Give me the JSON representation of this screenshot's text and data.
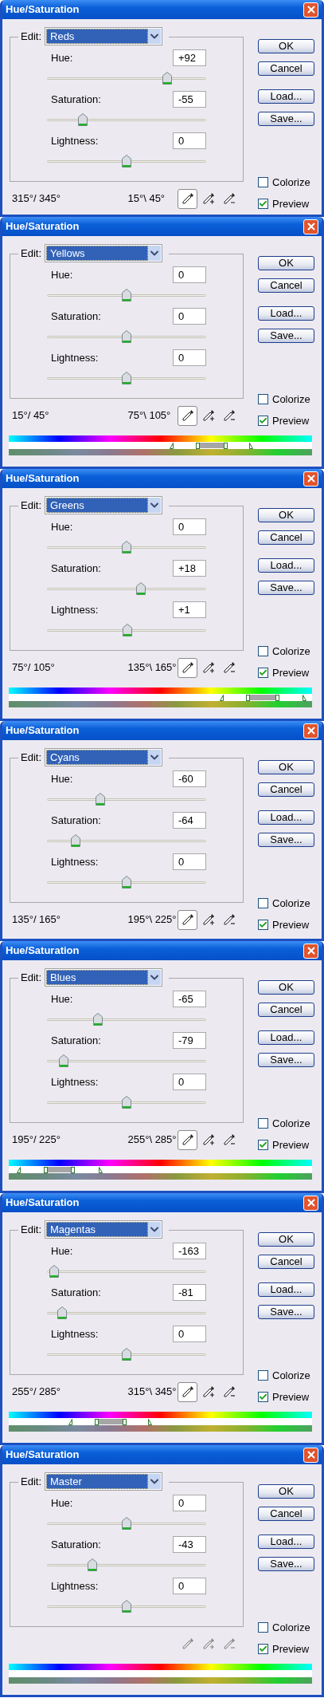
{
  "dialogs": [
    {
      "title": "Hue/Saturation",
      "edit_label": "Edit:",
      "edit_value": "Reds",
      "sliders": [
        {
          "label": "Hue:",
          "value": "+92",
          "level": 0.756
        },
        {
          "label": "Saturation:",
          "value": "-55",
          "level": 0.225
        },
        {
          "label": "Lightness:",
          "value": "0",
          "level": 0.5
        }
      ],
      "buttons": [
        "OK",
        "Cancel",
        "Load...",
        "Save..."
      ],
      "range_left": "315°/ 345°",
      "range_right": "15°\\ 45°",
      "eyedroppers": [
        {
          "kind": "plain",
          "selected": true,
          "disabled": false
        },
        {
          "kind": "add",
          "selected": false,
          "disabled": false
        },
        {
          "kind": "subtract",
          "selected": false,
          "disabled": false
        }
      ],
      "checkboxes": [
        {
          "label": "Colorize",
          "checked": false
        },
        {
          "label": "Preview",
          "checked": true
        }
      ],
      "color_bars": false
    },
    {
      "title": "Hue/Saturation",
      "edit_label": "Edit:",
      "edit_value": "Yellows",
      "sliders": [
        {
          "label": "Hue:",
          "value": "0",
          "level": 0.5
        },
        {
          "label": "Saturation:",
          "value": "0",
          "level": 0.5
        },
        {
          "label": "Lightness:",
          "value": "0",
          "level": 0.5
        }
      ],
      "buttons": [
        "OK",
        "Cancel",
        "Load...",
        "Save..."
      ],
      "range_left": "15°/ 45°",
      "range_right": "75°\\ 105°",
      "eyedroppers": [
        {
          "kind": "plain",
          "selected": true,
          "disabled": false
        },
        {
          "kind": "add",
          "selected": false,
          "disabled": false
        },
        {
          "kind": "subtract",
          "selected": false,
          "disabled": false
        }
      ],
      "checkboxes": [
        {
          "label": "Colorize",
          "checked": false
        },
        {
          "label": "Preview",
          "checked": true
        }
      ],
      "color_bars": true,
      "range_sliders": [
        {
          "level": 0.535
        },
        {
          "level": 0.622
        },
        {
          "level": 0.714
        },
        {
          "level": 0.798
        }
      ]
    },
    {
      "title": "Hue/Saturation",
      "edit_label": "Edit:",
      "edit_value": "Greens",
      "sliders": [
        {
          "label": "Hue:",
          "value": "0",
          "level": 0.5
        },
        {
          "label": "Saturation:",
          "value": "+18",
          "level": 0.59
        },
        {
          "label": "Lightness:",
          "value": "+1",
          "level": 0.505
        }
      ],
      "buttons": [
        "OK",
        "Cancel",
        "Load...",
        "Save..."
      ],
      "range_left": "75°/ 105°",
      "range_right": "135°\\ 165°",
      "eyedroppers": [
        {
          "kind": "plain",
          "selected": true,
          "disabled": false
        },
        {
          "kind": "add",
          "selected": false,
          "disabled": false
        },
        {
          "kind": "subtract",
          "selected": false,
          "disabled": false
        }
      ],
      "checkboxes": [
        {
          "label": "Colorize",
          "checked": false
        },
        {
          "label": "Preview",
          "checked": true
        }
      ],
      "color_bars": true,
      "range_sliders": [
        {
          "level": 0.702
        },
        {
          "level": 0.788
        },
        {
          "level": 0.885
        },
        {
          "level": 0.975
        }
      ]
    },
    {
      "title": "Hue/Saturation",
      "edit_label": "Edit:",
      "edit_value": "Cyans",
      "sliders": [
        {
          "label": "Hue:",
          "value": "-60",
          "level": 0.333
        },
        {
          "label": "Saturation:",
          "value": "-64",
          "level": 0.18
        },
        {
          "label": "Lightness:",
          "value": "0",
          "level": 0.5
        }
      ],
      "buttons": [
        "OK",
        "Cancel",
        "Load...",
        "Save..."
      ],
      "range_left": "135°/ 165°",
      "range_right": "195°\\ 225°",
      "eyedroppers": [
        {
          "kind": "plain",
          "selected": true,
          "disabled": false
        },
        {
          "kind": "add",
          "selected": false,
          "disabled": false
        },
        {
          "kind": "subtract",
          "selected": false,
          "disabled": false
        }
      ],
      "checkboxes": [
        {
          "label": "Colorize",
          "checked": false
        },
        {
          "label": "Preview",
          "checked": true
        }
      ],
      "color_bars": false
    },
    {
      "title": "Hue/Saturation",
      "edit_label": "Edit:",
      "edit_value": "Blues",
      "sliders": [
        {
          "label": "Hue:",
          "value": "-65",
          "level": 0.319
        },
        {
          "label": "Saturation:",
          "value": "-79",
          "level": 0.105
        },
        {
          "label": "Lightness:",
          "value": "0",
          "level": 0.5
        }
      ],
      "buttons": [
        "OK",
        "Cancel",
        "Load...",
        "Save..."
      ],
      "range_left": "195°/ 225°",
      "range_right": "255°\\ 285°",
      "eyedroppers": [
        {
          "kind": "plain",
          "selected": true,
          "disabled": false
        },
        {
          "kind": "add",
          "selected": false,
          "disabled": false
        },
        {
          "kind": "subtract",
          "selected": false,
          "disabled": false
        }
      ],
      "checkboxes": [
        {
          "label": "Colorize",
          "checked": false
        },
        {
          "label": "Preview",
          "checked": true
        }
      ],
      "color_bars": true,
      "range_sliders": [
        {
          "level": 0.032
        },
        {
          "level": 0.122
        },
        {
          "level": 0.211
        },
        {
          "level": 0.301
        }
      ]
    },
    {
      "title": "Hue/Saturation",
      "edit_label": "Edit:",
      "edit_value": "Magentas",
      "sliders": [
        {
          "label": "Hue:",
          "value": "-163",
          "level": 0.047
        },
        {
          "label": "Saturation:",
          "value": "-81",
          "level": 0.095
        },
        {
          "label": "Lightness:",
          "value": "0",
          "level": 0.5
        }
      ],
      "buttons": [
        "OK",
        "Cancel",
        "Load...",
        "Save..."
      ],
      "range_left": "255°/ 285°",
      "range_right": "315°\\ 345°",
      "eyedroppers": [
        {
          "kind": "plain",
          "selected": true,
          "disabled": false
        },
        {
          "kind": "add",
          "selected": false,
          "disabled": false
        },
        {
          "kind": "subtract",
          "selected": false,
          "disabled": false
        }
      ],
      "checkboxes": [
        {
          "label": "Colorize",
          "checked": false
        },
        {
          "label": "Preview",
          "checked": true
        }
      ],
      "color_bars": true,
      "range_sliders": [
        {
          "level": 0.202
        },
        {
          "level": 0.289
        },
        {
          "level": 0.381
        },
        {
          "level": 0.465
        }
      ]
    },
    {
      "title": "Hue/Saturation",
      "edit_label": "Edit:",
      "edit_value": "Master",
      "sliders": [
        {
          "label": "Hue:",
          "value": "0",
          "level": 0.5
        },
        {
          "label": "Saturation:",
          "value": "-43",
          "level": 0.285
        },
        {
          "label": "Lightness:",
          "value": "0",
          "level": 0.5
        }
      ],
      "buttons": [
        "OK",
        "Cancel",
        "Load...",
        "Save..."
      ],
      "eyedroppers": [
        {
          "kind": "plain",
          "selected": false,
          "disabled": true
        },
        {
          "kind": "add",
          "selected": false,
          "disabled": true
        },
        {
          "kind": "subtract",
          "selected": false,
          "disabled": true
        }
      ],
      "checkboxes": [
        {
          "label": "Colorize",
          "checked": false
        },
        {
          "label": "Preview",
          "checked": true
        }
      ],
      "color_bars": true
    }
  ]
}
